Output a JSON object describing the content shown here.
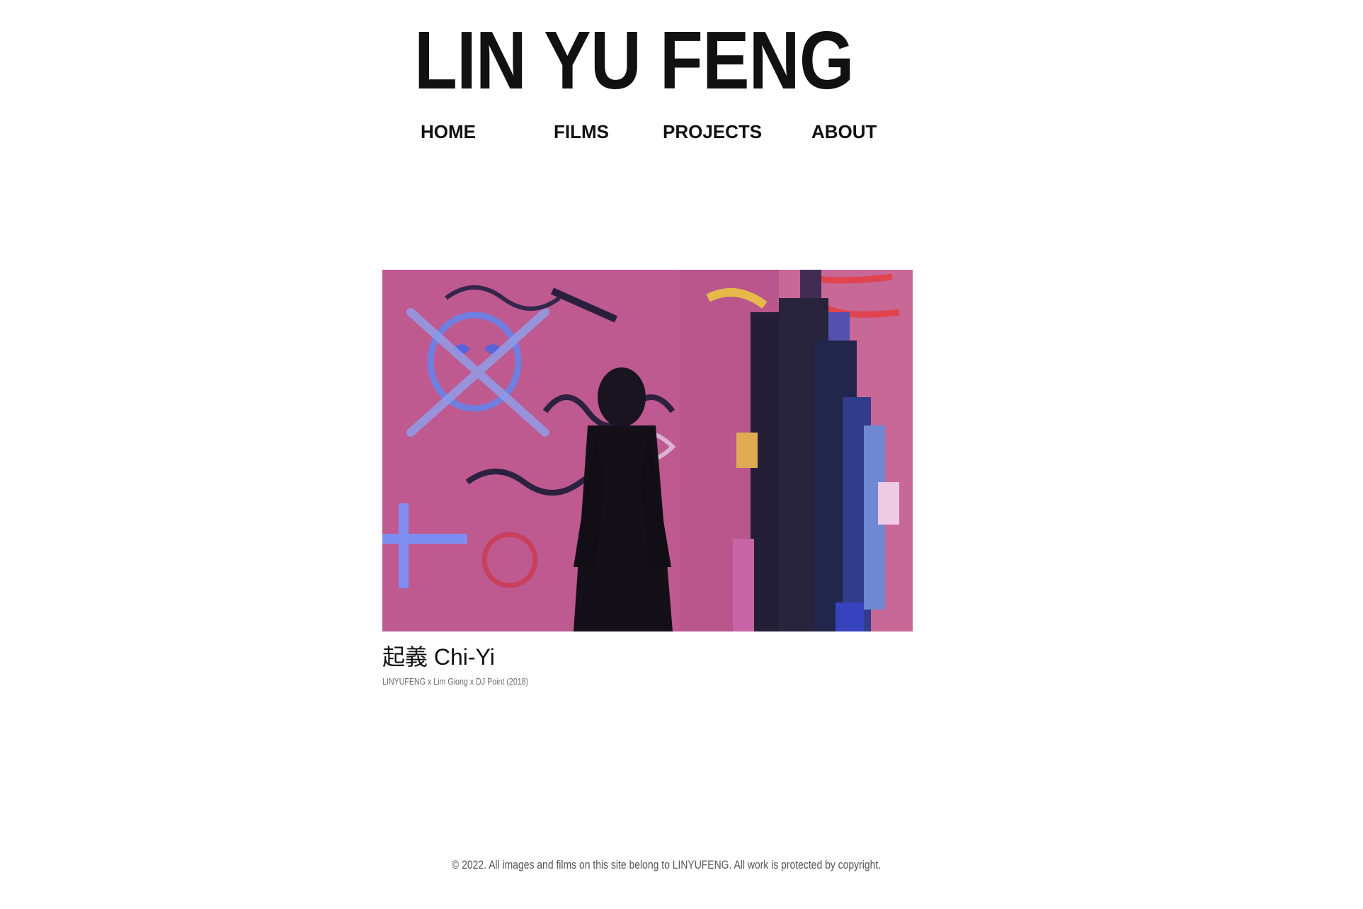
{
  "header": {
    "site_title": "LIN YU FENG"
  },
  "nav": {
    "items": [
      {
        "label": "HOME"
      },
      {
        "label": "FILMS"
      },
      {
        "label": "PROJECTS"
      },
      {
        "label": "ABOUT"
      }
    ]
  },
  "main": {
    "film": {
      "title": "起義 Chi-Yi",
      "credits": "LINYUFENG x Lim Giong x DJ Point (2018)",
      "thumbnail_icon": "film-still-image"
    }
  },
  "footer": {
    "copyright": "© 2022. All images and films on this site belong to LINYUFENG. All work is protected by copyright."
  },
  "colors": {
    "background": "#ffffff",
    "text": "#111111",
    "muted_text": "#6b6b6b",
    "thumb_pink": "#c2588f"
  }
}
